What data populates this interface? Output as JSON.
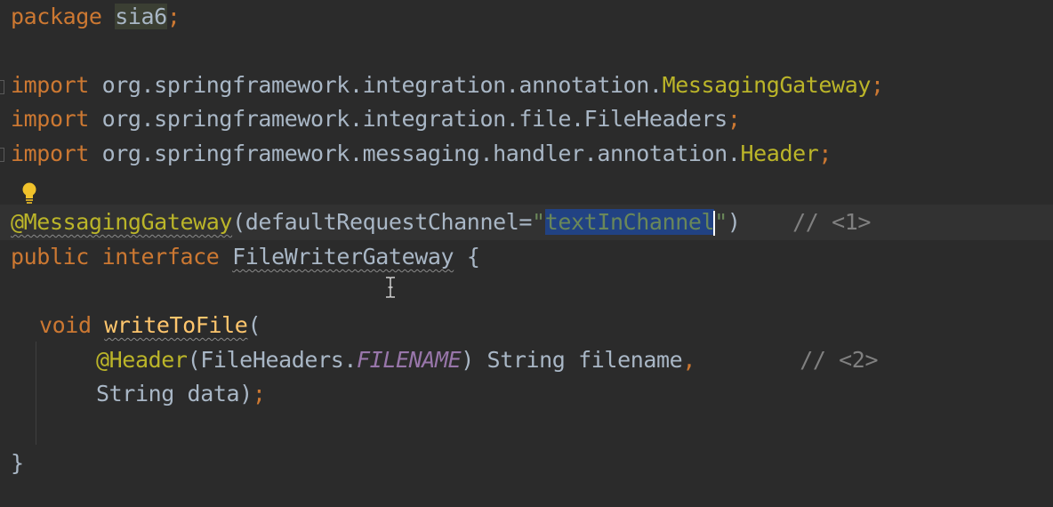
{
  "editor": {
    "lines": {
      "package": {
        "kw": "package",
        "name": "sia6",
        "semi": ";"
      },
      "import1": {
        "kw": "import",
        "path": " org.springframework.integration.annotation.",
        "cls": "MessagingGateway",
        "semi": ";"
      },
      "import2": {
        "kw": "import",
        "path": " org.springframework.integration.file.FileHeaders",
        "semi": ";"
      },
      "import3": {
        "kw": "import",
        "path": " org.springframework.messaging.handler.annotation.",
        "cls": "Header",
        "semi": ";"
      },
      "annotation": {
        "at": "@MessagingGateway",
        "open": "(defaultRequestChannel=",
        "quote_open": "\"",
        "value": "textInChannel",
        "quote_close": "\"",
        "close": ")",
        "comment": "// <1>"
      },
      "iface": {
        "kw1": "public",
        "kw2": "interface",
        "name": "FileWriterGateway",
        "brace": " {"
      },
      "method": {
        "kw": "void",
        "name": "writeToFile",
        "paren": "("
      },
      "param1": {
        "at": "@Header",
        "open": "(FileHeaders.",
        "const": "FILENAME",
        "rest": ") String filename",
        "comma": ",",
        "comment": "// <2>"
      },
      "param2": {
        "text": "String data)",
        "semi": ";"
      },
      "close": {
        "text": "}"
      }
    }
  },
  "icons": {
    "bulb": "lightbulb-icon",
    "cursor": "text-cursor-icon"
  },
  "colors": {
    "background": "#2b2b2b",
    "keyword": "#cc7832",
    "annotation": "#bbb529",
    "string": "#6a8759",
    "comment": "#808080",
    "constant": "#9876aa",
    "method": "#ffc66d",
    "selection": "#214283"
  }
}
